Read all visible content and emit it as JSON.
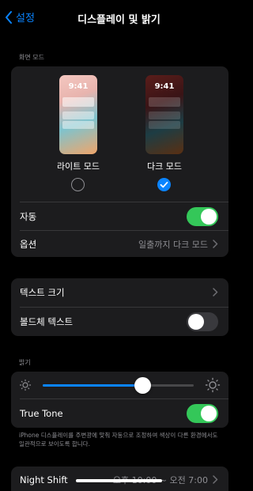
{
  "nav": {
    "back_label": "설정",
    "title": "디스플레이 및 밝기"
  },
  "appearance": {
    "section_label": "화면 모드",
    "light": {
      "time": "9:41",
      "label": "라이트 모드",
      "selected": false
    },
    "dark": {
      "time": "9:41",
      "label": "다크 모드",
      "selected": true
    },
    "auto_label": "자동",
    "auto_on": true,
    "options_label": "옵션",
    "options_value": "일출까지 다크 모드"
  },
  "text": {
    "size_label": "텍스트 크기",
    "bold_label": "볼드체 텍스트",
    "bold_on": false
  },
  "brightness": {
    "section_label": "밝기",
    "level": 0.66,
    "true_tone_label": "True Tone",
    "true_tone_on": true,
    "footnote": "iPhone 디스플레이를 주변광에 맞춰 자동으로 조정하여 색상이 다른 환경에서도 일관적으로 보이도록 합니다."
  },
  "night_shift": {
    "label": "Night Shift",
    "value": "오후 10:00 ~ 오전 7:00"
  },
  "colors": {
    "accent": "#0a84ff",
    "toggle_on": "#34c759",
    "group_bg": "#1c1c1e"
  }
}
